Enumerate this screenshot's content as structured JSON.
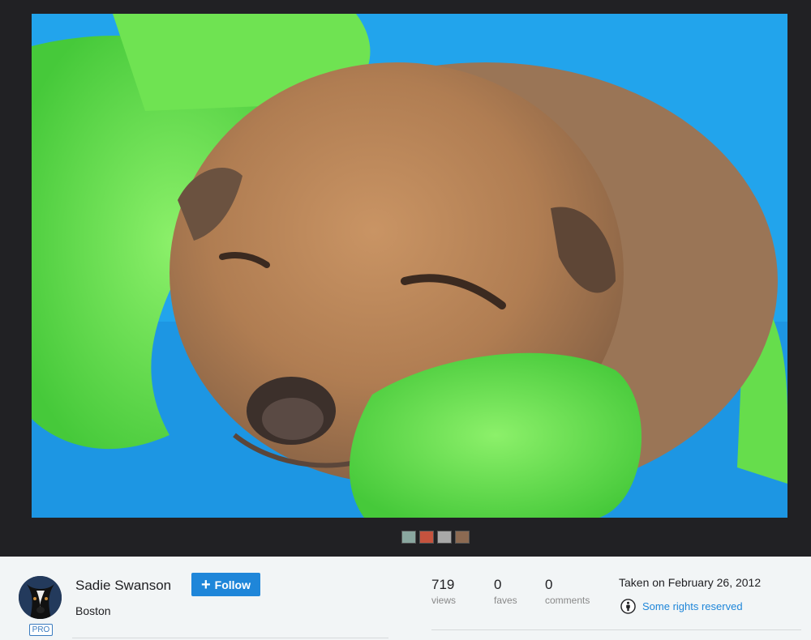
{
  "photo": {
    "description_icon": "puppy-photo",
    "thumbnails": [
      "thumb-1",
      "thumb-2",
      "thumb-3",
      "thumb-4"
    ]
  },
  "owner": {
    "name": "Sadie Swanson",
    "badge": "PRO",
    "follow_label": "Follow",
    "location": "Boston"
  },
  "stats": [
    {
      "value": "719",
      "label": "views"
    },
    {
      "value": "0",
      "label": "faves"
    },
    {
      "value": "0",
      "label": "comments"
    }
  ],
  "meta": {
    "taken": "Taken on February 26, 2012",
    "license": "Some rights reserved"
  },
  "colors": {
    "accent": "#1f86d9",
    "viewer_bg": "#212124"
  }
}
